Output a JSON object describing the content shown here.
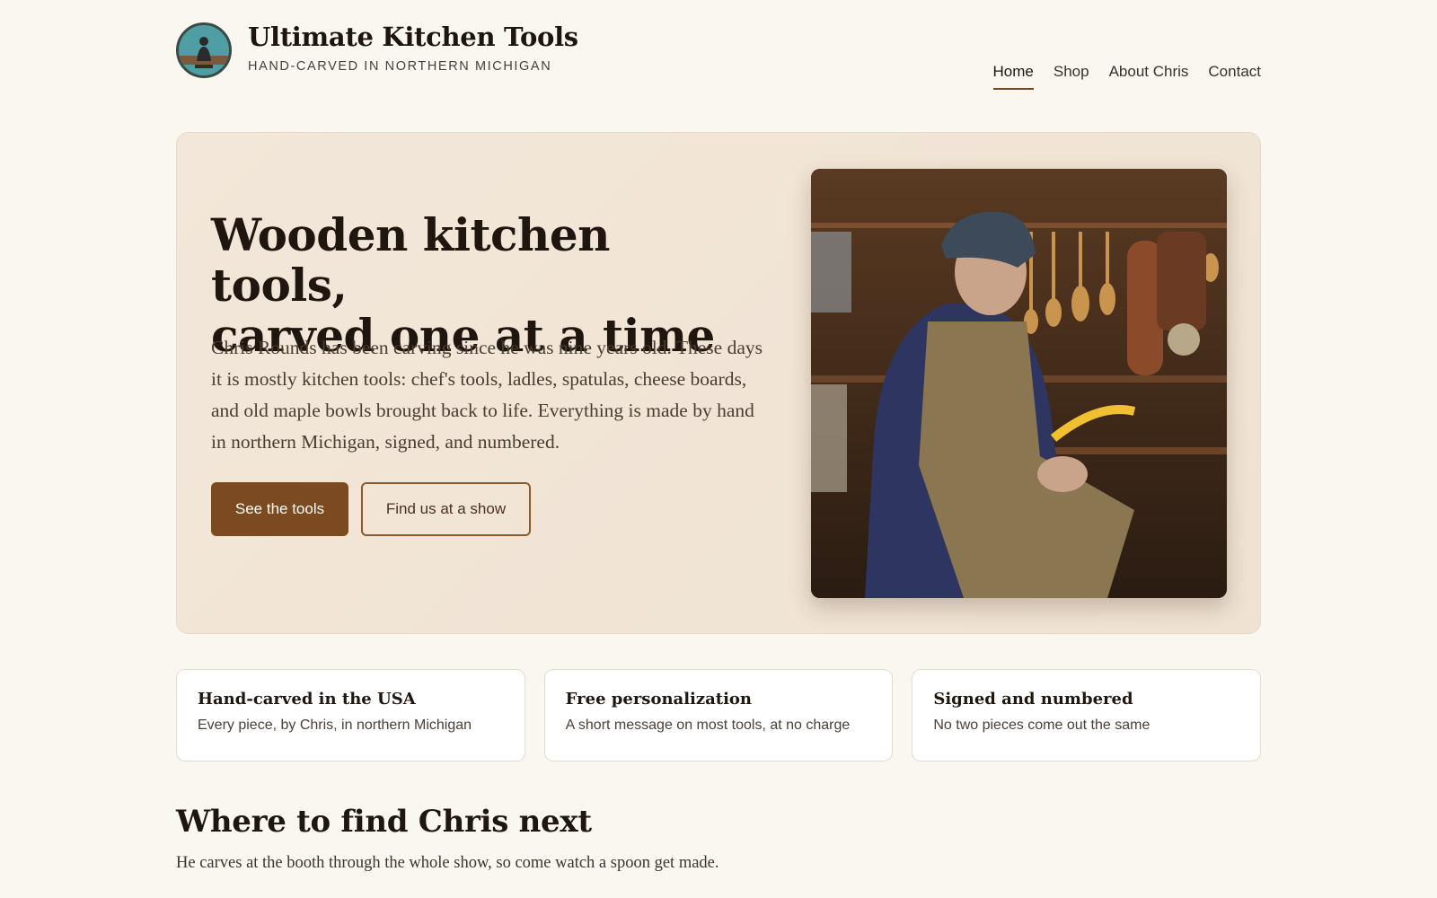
{
  "site": {
    "title": "Ultimate Kitchen Tools",
    "tagline": "HAND-CARVED IN NORTHERN MICHIGAN",
    "logo_icon": "carver-emblem-logo"
  },
  "nav": {
    "items": [
      {
        "label": "Home",
        "active": true
      },
      {
        "label": "Shop",
        "active": false
      },
      {
        "label": "About Chris",
        "active": false
      },
      {
        "label": "Contact",
        "active": false
      }
    ]
  },
  "hero": {
    "heading_line1": "Wooden kitchen tools,",
    "heading_line2": "carved one at a time",
    "body": "Chris Rounds has been carving since he was nine years old. These days it is mostly kitchen tools: chef's tools, ladles, spatulas, cheese boards, and old maple bowls brought back to life. Everything is made by hand in northern Michigan, signed, and numbered.",
    "primary_button": "See the tools",
    "secondary_button": "Find us at a show"
  },
  "features": [
    {
      "title": "Hand-carved in the USA",
      "text": "Every piece, by Chris, in northern Michigan"
    },
    {
      "title": "Free personalization",
      "text": "A short message on most tools, at no charge"
    },
    {
      "title": "Signed and numbered",
      "text": "No two pieces come out the same"
    }
  ],
  "where": {
    "heading": "Where to find Chris next",
    "subtext": "He carves at the booth through the whole show, so come watch a spoon get made."
  },
  "colors": {
    "accent": "#7b4a20",
    "background": "#faf6f0",
    "hero_bg": "#f3e7d9"
  }
}
